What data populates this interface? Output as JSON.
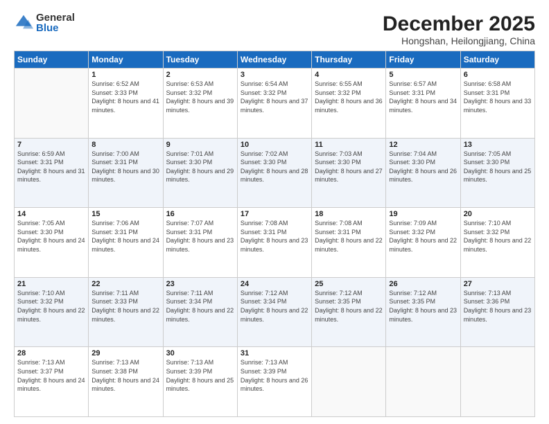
{
  "logo": {
    "general": "General",
    "blue": "Blue"
  },
  "title": "December 2025",
  "subtitle": "Hongshan, Heilongjiang, China",
  "days_of_week": [
    "Sunday",
    "Monday",
    "Tuesday",
    "Wednesday",
    "Thursday",
    "Friday",
    "Saturday"
  ],
  "weeks": [
    [
      {
        "day": "",
        "sunrise": "",
        "sunset": "",
        "daylight": ""
      },
      {
        "day": "1",
        "sunrise": "Sunrise: 6:52 AM",
        "sunset": "Sunset: 3:33 PM",
        "daylight": "Daylight: 8 hours and 41 minutes."
      },
      {
        "day": "2",
        "sunrise": "Sunrise: 6:53 AM",
        "sunset": "Sunset: 3:32 PM",
        "daylight": "Daylight: 8 hours and 39 minutes."
      },
      {
        "day": "3",
        "sunrise": "Sunrise: 6:54 AM",
        "sunset": "Sunset: 3:32 PM",
        "daylight": "Daylight: 8 hours and 37 minutes."
      },
      {
        "day": "4",
        "sunrise": "Sunrise: 6:55 AM",
        "sunset": "Sunset: 3:32 PM",
        "daylight": "Daylight: 8 hours and 36 minutes."
      },
      {
        "day": "5",
        "sunrise": "Sunrise: 6:57 AM",
        "sunset": "Sunset: 3:31 PM",
        "daylight": "Daylight: 8 hours and 34 minutes."
      },
      {
        "day": "6",
        "sunrise": "Sunrise: 6:58 AM",
        "sunset": "Sunset: 3:31 PM",
        "daylight": "Daylight: 8 hours and 33 minutes."
      }
    ],
    [
      {
        "day": "7",
        "sunrise": "Sunrise: 6:59 AM",
        "sunset": "Sunset: 3:31 PM",
        "daylight": "Daylight: 8 hours and 31 minutes."
      },
      {
        "day": "8",
        "sunrise": "Sunrise: 7:00 AM",
        "sunset": "Sunset: 3:31 PM",
        "daylight": "Daylight: 8 hours and 30 minutes."
      },
      {
        "day": "9",
        "sunrise": "Sunrise: 7:01 AM",
        "sunset": "Sunset: 3:30 PM",
        "daylight": "Daylight: 8 hours and 29 minutes."
      },
      {
        "day": "10",
        "sunrise": "Sunrise: 7:02 AM",
        "sunset": "Sunset: 3:30 PM",
        "daylight": "Daylight: 8 hours and 28 minutes."
      },
      {
        "day": "11",
        "sunrise": "Sunrise: 7:03 AM",
        "sunset": "Sunset: 3:30 PM",
        "daylight": "Daylight: 8 hours and 27 minutes."
      },
      {
        "day": "12",
        "sunrise": "Sunrise: 7:04 AM",
        "sunset": "Sunset: 3:30 PM",
        "daylight": "Daylight: 8 hours and 26 minutes."
      },
      {
        "day": "13",
        "sunrise": "Sunrise: 7:05 AM",
        "sunset": "Sunset: 3:30 PM",
        "daylight": "Daylight: 8 hours and 25 minutes."
      }
    ],
    [
      {
        "day": "14",
        "sunrise": "Sunrise: 7:05 AM",
        "sunset": "Sunset: 3:30 PM",
        "daylight": "Daylight: 8 hours and 24 minutes."
      },
      {
        "day": "15",
        "sunrise": "Sunrise: 7:06 AM",
        "sunset": "Sunset: 3:31 PM",
        "daylight": "Daylight: 8 hours and 24 minutes."
      },
      {
        "day": "16",
        "sunrise": "Sunrise: 7:07 AM",
        "sunset": "Sunset: 3:31 PM",
        "daylight": "Daylight: 8 hours and 23 minutes."
      },
      {
        "day": "17",
        "sunrise": "Sunrise: 7:08 AM",
        "sunset": "Sunset: 3:31 PM",
        "daylight": "Daylight: 8 hours and 23 minutes."
      },
      {
        "day": "18",
        "sunrise": "Sunrise: 7:08 AM",
        "sunset": "Sunset: 3:31 PM",
        "daylight": "Daylight: 8 hours and 22 minutes."
      },
      {
        "day": "19",
        "sunrise": "Sunrise: 7:09 AM",
        "sunset": "Sunset: 3:32 PM",
        "daylight": "Daylight: 8 hours and 22 minutes."
      },
      {
        "day": "20",
        "sunrise": "Sunrise: 7:10 AM",
        "sunset": "Sunset: 3:32 PM",
        "daylight": "Daylight: 8 hours and 22 minutes."
      }
    ],
    [
      {
        "day": "21",
        "sunrise": "Sunrise: 7:10 AM",
        "sunset": "Sunset: 3:32 PM",
        "daylight": "Daylight: 8 hours and 22 minutes."
      },
      {
        "day": "22",
        "sunrise": "Sunrise: 7:11 AM",
        "sunset": "Sunset: 3:33 PM",
        "daylight": "Daylight: 8 hours and 22 minutes."
      },
      {
        "day": "23",
        "sunrise": "Sunrise: 7:11 AM",
        "sunset": "Sunset: 3:34 PM",
        "daylight": "Daylight: 8 hours and 22 minutes."
      },
      {
        "day": "24",
        "sunrise": "Sunrise: 7:12 AM",
        "sunset": "Sunset: 3:34 PM",
        "daylight": "Daylight: 8 hours and 22 minutes."
      },
      {
        "day": "25",
        "sunrise": "Sunrise: 7:12 AM",
        "sunset": "Sunset: 3:35 PM",
        "daylight": "Daylight: 8 hours and 22 minutes."
      },
      {
        "day": "26",
        "sunrise": "Sunrise: 7:12 AM",
        "sunset": "Sunset: 3:35 PM",
        "daylight": "Daylight: 8 hours and 23 minutes."
      },
      {
        "day": "27",
        "sunrise": "Sunrise: 7:13 AM",
        "sunset": "Sunset: 3:36 PM",
        "daylight": "Daylight: 8 hours and 23 minutes."
      }
    ],
    [
      {
        "day": "28",
        "sunrise": "Sunrise: 7:13 AM",
        "sunset": "Sunset: 3:37 PM",
        "daylight": "Daylight: 8 hours and 24 minutes."
      },
      {
        "day": "29",
        "sunrise": "Sunrise: 7:13 AM",
        "sunset": "Sunset: 3:38 PM",
        "daylight": "Daylight: 8 hours and 24 minutes."
      },
      {
        "day": "30",
        "sunrise": "Sunrise: 7:13 AM",
        "sunset": "Sunset: 3:39 PM",
        "daylight": "Daylight: 8 hours and 25 minutes."
      },
      {
        "day": "31",
        "sunrise": "Sunrise: 7:13 AM",
        "sunset": "Sunset: 3:39 PM",
        "daylight": "Daylight: 8 hours and 26 minutes."
      },
      {
        "day": "",
        "sunrise": "",
        "sunset": "",
        "daylight": ""
      },
      {
        "day": "",
        "sunrise": "",
        "sunset": "",
        "daylight": ""
      },
      {
        "day": "",
        "sunrise": "",
        "sunset": "",
        "daylight": ""
      }
    ]
  ]
}
